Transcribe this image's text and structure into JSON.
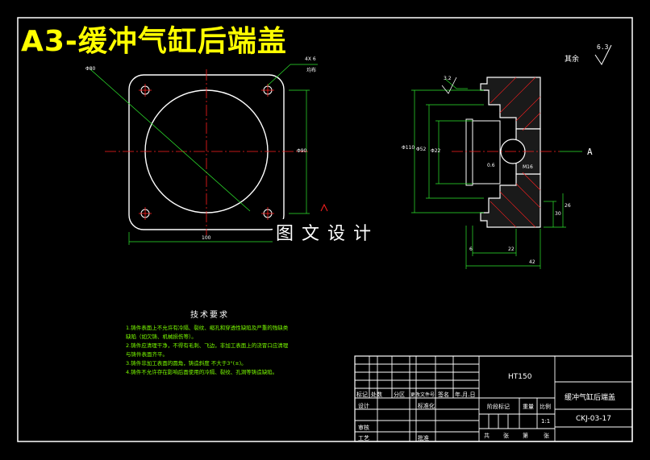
{
  "title": "A3-缓冲气缸后端盖",
  "watermark": "图文设计",
  "roughness": {
    "note": "其余",
    "value": "6.3"
  },
  "section_label": "A",
  "hole_note": {
    "count": "4X 6",
    "depth": "均布"
  },
  "front_view_dims": {
    "diameter_label": "Φ80",
    "width": "100",
    "height": "Φ90"
  },
  "section_dims": {
    "outer_dia": "Φ110",
    "bore_dia": "Φ52",
    "inner_dia": "Φ22",
    "thread": "M16",
    "roughness_a": "3.2",
    "roughness_b": "0.6",
    "len_1": "6",
    "len_2": "22",
    "len_3": "42",
    "h1": "30",
    "h2": "26"
  },
  "tech_requirements": {
    "title": "技术要求",
    "items": [
      "1.铸件表面上不允许有冷隔、裂纹、缩孔和穿透性缺陷及严重的残缺类",
      "缺陷（如欠铸、机械损伤等）。",
      "2.铸件应清理干净，不得有毛刺、飞边，非加工表面上的浇冒口应清理",
      "与铸件表面齐平。",
      "3.铸件非加工表面的圆角，铸造斜度 不大于3°(±)。",
      "4.铸件不允许存在影响后面使用的冷隔、裂纹、孔洞等铸造缺陷。"
    ]
  },
  "title_block": {
    "material": "HT150",
    "part_name": "缓冲气缸后端盖",
    "drawing_no": "CKJ-03-17",
    "scale": "1:1",
    "headers": [
      "标记",
      "处数",
      "分区",
      "更改文件号",
      "签名",
      "年.月.日"
    ],
    "rows": [
      "设计",
      "标准化",
      "审核",
      "工艺",
      "批准"
    ],
    "stage_label": "阶段标记",
    "weight_label": "重量",
    "scale_label": "比例",
    "sheet_labels": [
      "共",
      "张",
      "第",
      "张"
    ]
  }
}
